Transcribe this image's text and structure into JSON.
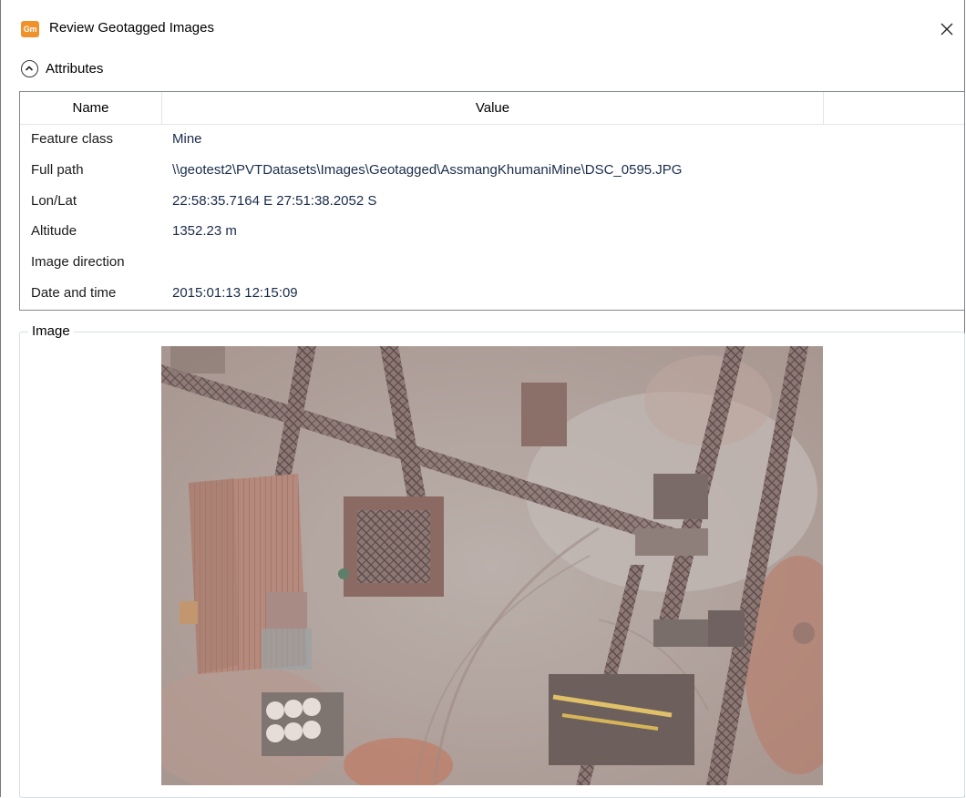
{
  "window": {
    "title": "Review Geotagged Images",
    "app_icon_text": "Gm",
    "accent_color": "#f0922b"
  },
  "attributes": {
    "section_label": "Attributes",
    "columns": [
      "Name",
      "Value",
      ""
    ],
    "rows": [
      {
        "name": "Feature class",
        "value": "Mine"
      },
      {
        "name": "Full path",
        "value": "\\\\geotest2\\PVTDatasets\\Images\\Geotagged\\AssmangKhumaniMine\\DSC_0595.JPG"
      },
      {
        "name": "Lon/Lat",
        "value": "22:58:35.7164 E  27:51:38.2052 S"
      },
      {
        "name": "Altitude",
        "value": "1352.23 m"
      },
      {
        "name": "Image direction",
        "value": ""
      },
      {
        "name": "Date and time",
        "value": "2015:01:13 12:15:09"
      }
    ]
  },
  "image_section": {
    "label": "Image"
  }
}
